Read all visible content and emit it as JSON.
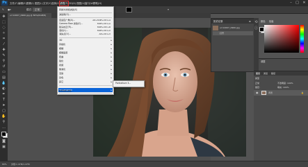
{
  "app": {
    "logo": "Ps"
  },
  "menubar": {
    "items": [
      "文件(F)",
      "编辑(E)",
      "图像(I)",
      "图层(L)",
      "文字(Y)",
      "选择(S)",
      "滤镜(T)",
      "3D(D)",
      "视图(V)",
      "窗口(W)",
      "帮助(H)"
    ]
  },
  "options": {
    "mode_label": "模式:",
    "mode_value": "正常"
  },
  "document": {
    "tab_title": "u=12007_0960.jpg @ 80%(RGB/8)"
  },
  "filter_menu": {
    "items": [
      {
        "label": "转换为智能滤镜(S)",
        "shortcut": ""
      },
      {
        "label": "滤镜库(G)...",
        "shortcut": ""
      },
      {
        "label": "自适应广角(A)...",
        "shortcut": "Alt+Shift+Ctrl+A"
      },
      {
        "label": "Camera Raw 滤镜(C)...",
        "shortcut": "Shift+Ctrl+A"
      },
      {
        "label": "镜头校正(R)...",
        "shortcut": "Shift+Ctrl+R"
      },
      {
        "label": "液化(L)...",
        "shortcut": "Shift+Ctrl+X"
      },
      {
        "label": "消失点(V)...",
        "shortcut": "Alt+Ctrl+V"
      },
      {
        "label": "3D",
        "shortcut": ""
      },
      {
        "label": "风格化",
        "shortcut": ""
      },
      {
        "label": "模糊",
        "shortcut": ""
      },
      {
        "label": "模糊画廊",
        "shortcut": ""
      },
      {
        "label": "扭曲",
        "shortcut": ""
      },
      {
        "label": "锐化",
        "shortcut": ""
      },
      {
        "label": "视频",
        "shortcut": ""
      },
      {
        "label": "像素化",
        "shortcut": ""
      },
      {
        "label": "渲染",
        "shortcut": ""
      },
      {
        "label": "杂色",
        "shortcut": ""
      },
      {
        "label": "其它",
        "shortcut": ""
      },
      {
        "label": "Imagenomic",
        "shortcut": ""
      },
      {
        "label": "浏览联机滤镜...",
        "shortcut": ""
      }
    ],
    "highlighted": "Imagenomic",
    "submenu": "Portraiture 3..."
  },
  "history": {
    "tab_label": "历史记录",
    "entries": [
      "u=12007_0960.jpg",
      "打开"
    ]
  },
  "color_panel": {
    "tabs": [
      "颜色",
      "色板"
    ]
  },
  "adjust_panel": {
    "tab": "调整"
  },
  "layers_panel": {
    "tabs": [
      "图层",
      "通道",
      "路径"
    ],
    "kind_label": "类型",
    "blend_mode": "正常",
    "opacity": "不透明度: 100%",
    "lock_label": "锁定:",
    "fill": "填充: 100%",
    "layer_name": "背景"
  },
  "status": {
    "zoom": "80%",
    "doc": "文档:1.47M/1.47M"
  },
  "colors": {
    "accent": "#0a64d8",
    "active_menu_outline": "#dd3333"
  }
}
